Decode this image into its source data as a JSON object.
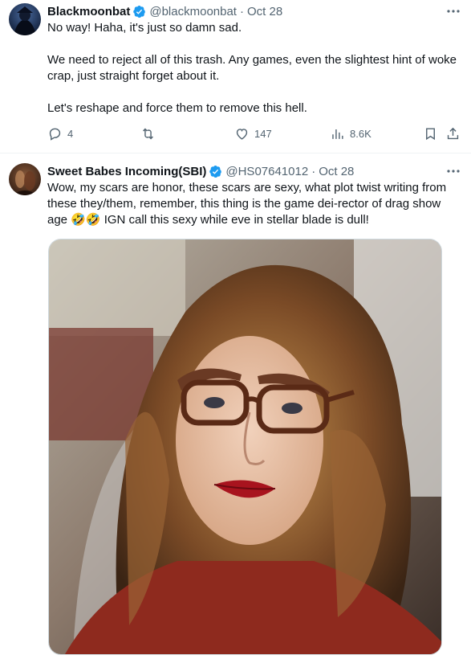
{
  "tweets": [
    {
      "author_name": "Blackmoonbat",
      "handle": "@blackmoonbat",
      "separator": "·",
      "date": "Oct 28",
      "paragraphs": [
        "No way! Haha, it's just so damn sad.",
        "We need to reject all of this trash. Any games, even the slightest hint of woke crap, just straight forget about it.",
        "Let's reshape and force them to remove this hell."
      ],
      "replies": "4",
      "retweets": "",
      "likes": "147",
      "views": "8.6K"
    },
    {
      "author_name": "Sweet Babes Incoming(SBI)",
      "handle": "@HS07641012",
      "separator": "·",
      "date": "Oct 28",
      "text": "Wow, my scars are honor, these scars are sexy, what plot twist writing from these they/them, remember, this thing is the game dei-rector of drag show age 🤣🤣 IGN call this sexy while eve in stellar blade is dull!"
    }
  ],
  "icons": {
    "verified": "verified-badge-icon",
    "more": "more-dots-icon",
    "reply": "reply-icon",
    "retweet": "retweet-icon",
    "like": "like-heart-icon",
    "views": "views-chart-icon",
    "bookmark": "bookmark-icon",
    "share": "share-icon"
  },
  "colors": {
    "verified_blue": "#1d9bf0",
    "secondary_text": "#536471",
    "divider": "#eff3f4"
  }
}
